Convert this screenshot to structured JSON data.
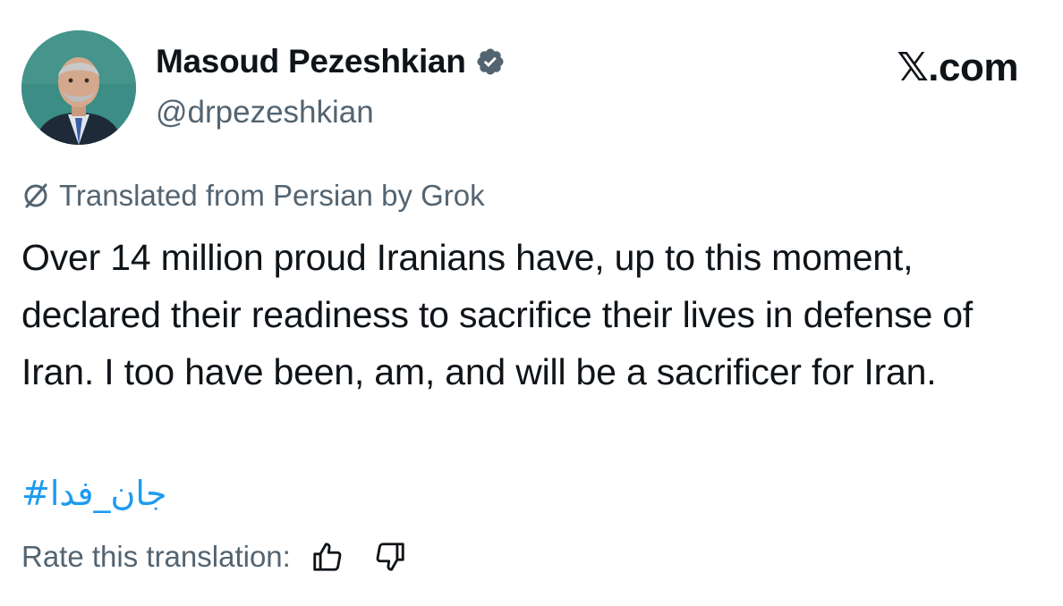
{
  "author": {
    "display_name": "Masoud Pezeshkian",
    "handle": "@drpezeshkian",
    "verified": true,
    "verified_color": "#536471"
  },
  "brand": "𝕏.com",
  "translation": {
    "notice": "Translated from Persian by Grok",
    "rate_label": "Rate this translation:"
  },
  "post": {
    "text": "Over 14 million proud Iranians have, up to this moment, declared their readiness to sacrifice their lives in defense of Iran. I too have been, am, and will be a sacrificer for Iran.",
    "hashtag": "#جان_فدا",
    "hashtag_color": "#1d9bf0"
  },
  "icons": {
    "verified": "verified-badge-icon",
    "translate": "grok-slash-icon",
    "thumbs_up": "thumbs-up-icon",
    "thumbs_down": "thumbs-down-icon"
  }
}
